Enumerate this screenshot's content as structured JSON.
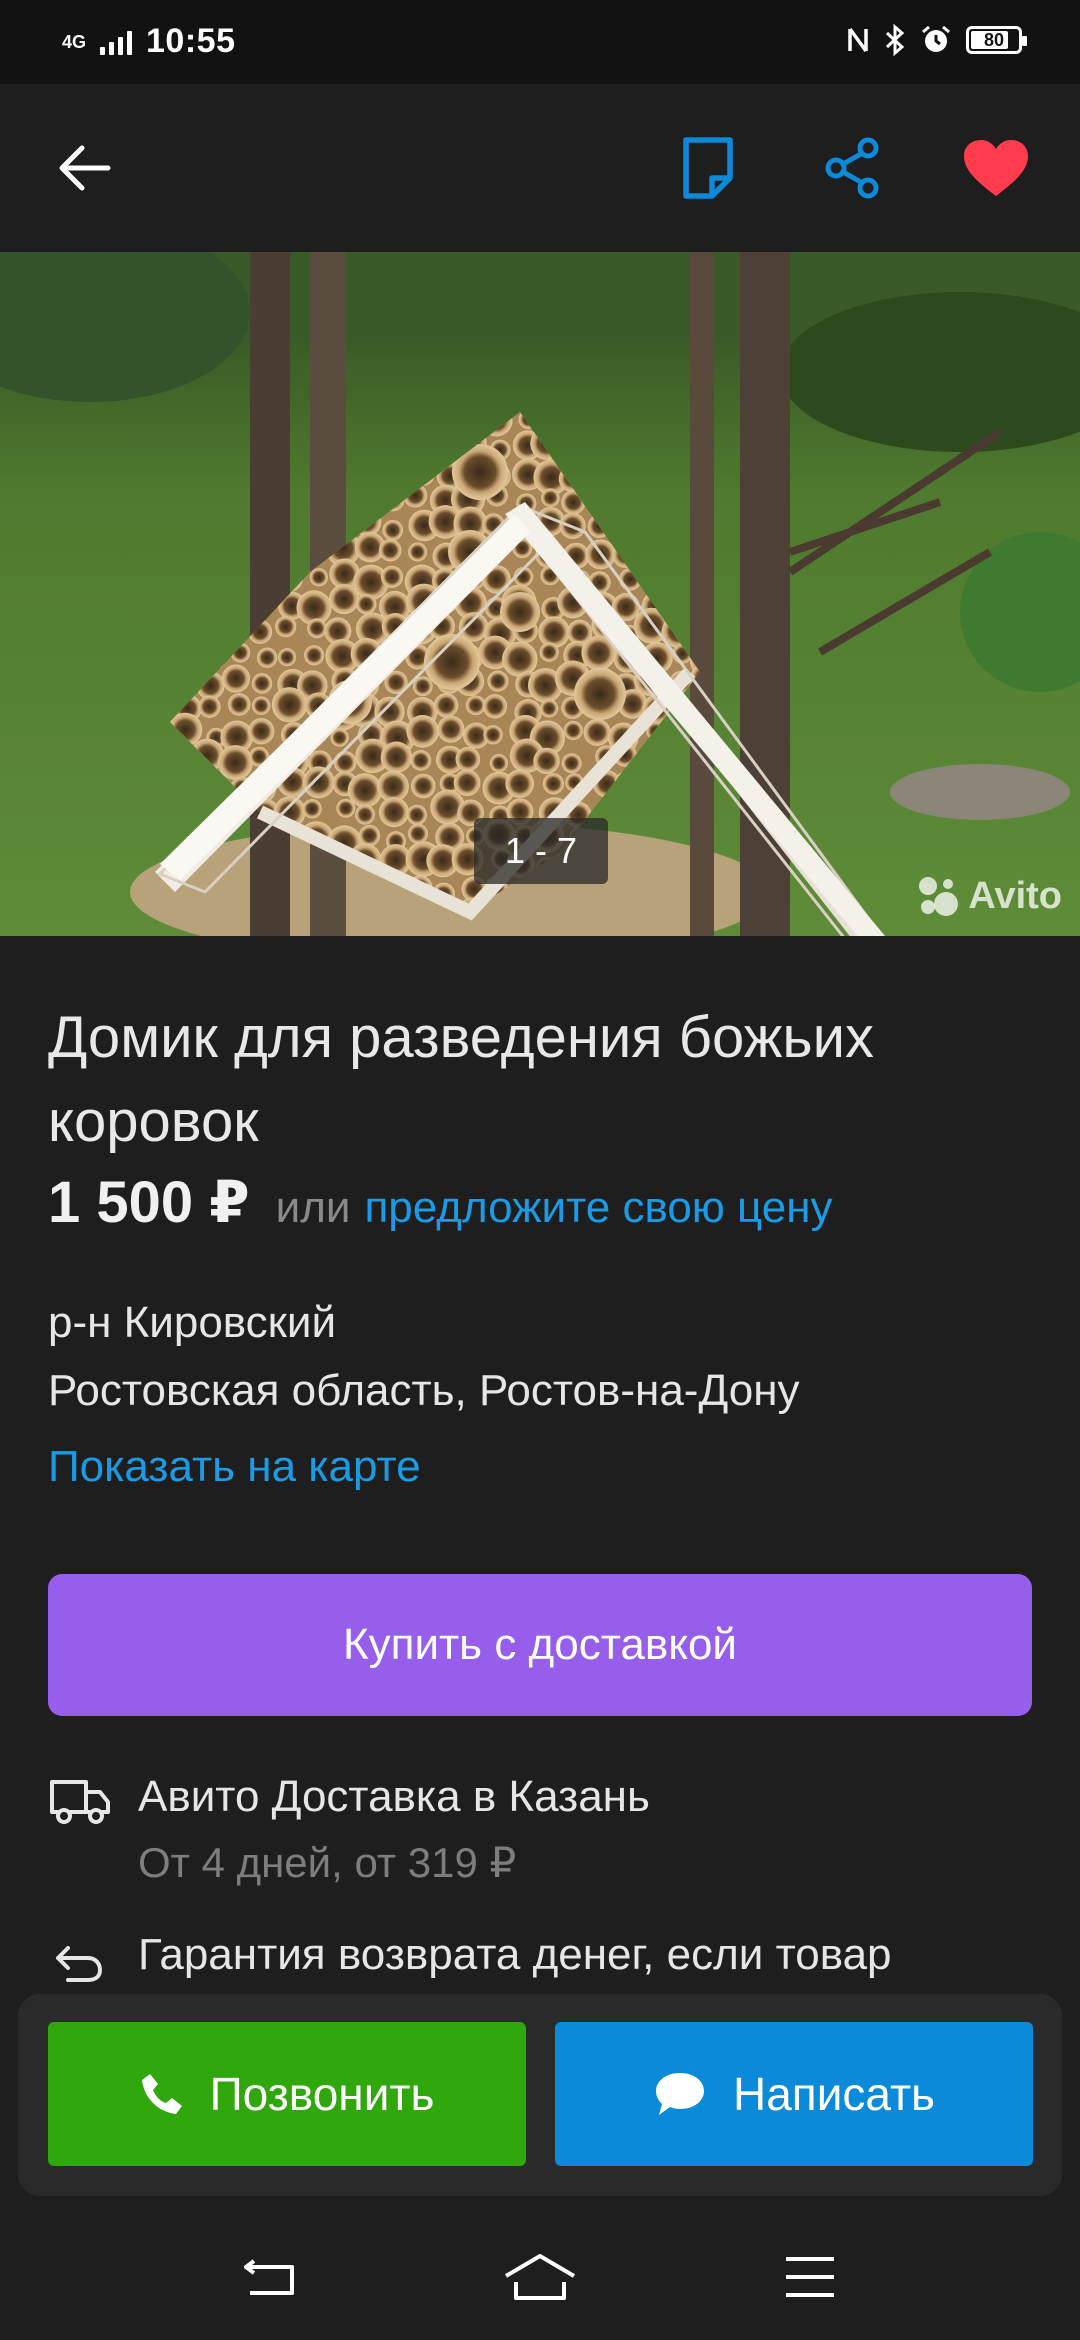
{
  "status_bar": {
    "network": "4G",
    "time": "10:55",
    "battery": "80",
    "battery_level": 0.8
  },
  "toolbar": {
    "icons": [
      "back-arrow-icon",
      "note-icon",
      "share-icon",
      "heart-icon"
    ],
    "accent_color": "#0a8ad9",
    "favorite_color": "#ff3b4e"
  },
  "gallery": {
    "counter": "1 - 7",
    "watermark": "Avito"
  },
  "listing": {
    "title": "Домик для разведения божьих коровок",
    "price": "1 500 ₽",
    "or_text": "или",
    "offer_link": "предложите свою цену",
    "district": "р-н Кировский",
    "region": "Ростовская область, Ростов-на-Дону",
    "map_link": "Показать на карте",
    "buy_button": "Купить с доставкой",
    "delivery_title": "Авито Доставка в Казань",
    "delivery_sub": "От 4 дней, от 319 ₽",
    "return_text": "Гарантия возврата денег, если товар"
  },
  "actions": {
    "call_label": "Позвонить",
    "write_label": "Написать",
    "call_color": "#2fa70d",
    "write_color": "#0a8ad9",
    "buy_color": "#965eeb"
  },
  "navbar": {
    "icons": [
      "back-icon",
      "home-icon",
      "menu-icon"
    ]
  }
}
